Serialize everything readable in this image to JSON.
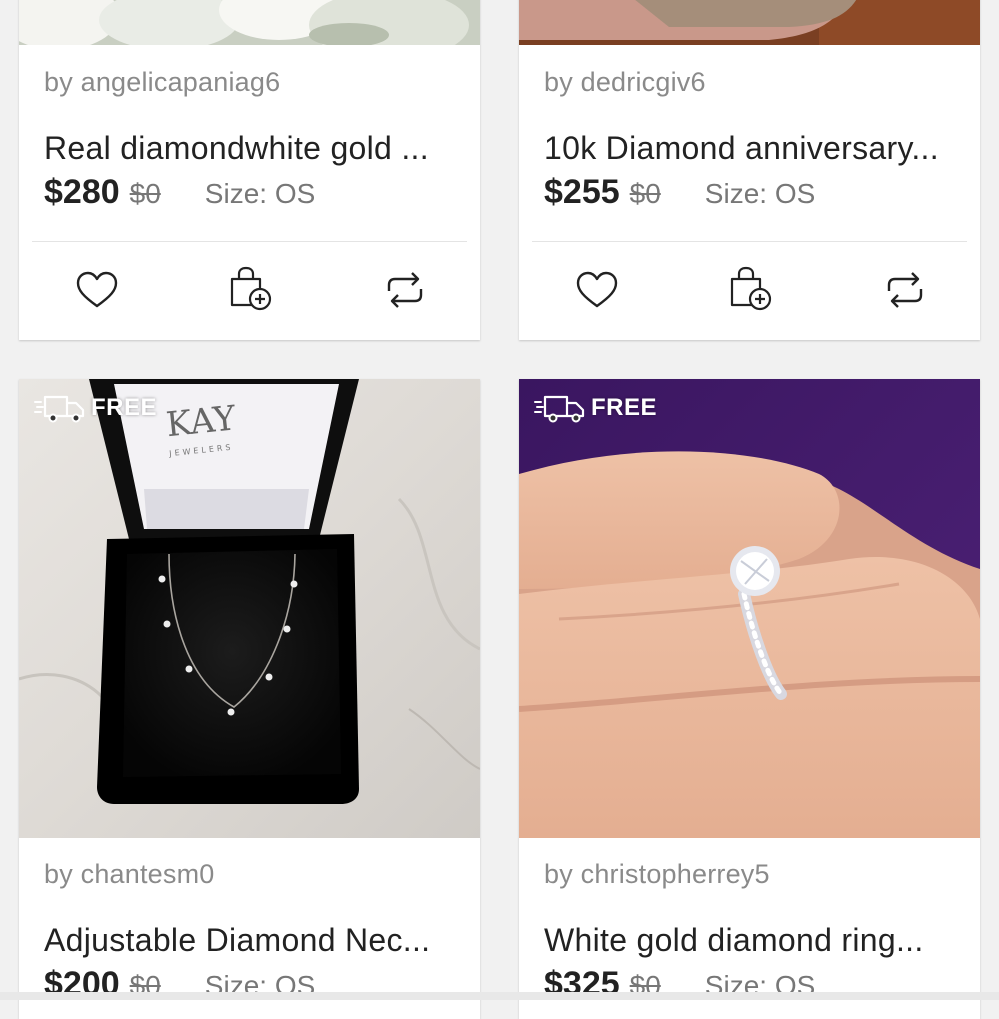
{
  "listings": [
    {
      "seller": "by angelicapaniag6",
      "title": "Real diamondwhite gold ...",
      "price": "$280",
      "original_price": "$0",
      "size": "Size: OS",
      "photo_desc": "white flowers"
    },
    {
      "seller": "by dedricgiv6",
      "title": "10k Diamond anniversary...",
      "price": "$255",
      "original_price": "$0",
      "size": "Size: OS",
      "photo_desc": "finger on wood"
    },
    {
      "seller": "by chantesm0",
      "title": "Adjustable Diamond Nec...",
      "price": "$200",
      "original_price": "$0",
      "size": "Size: OS",
      "badge": "FREE",
      "box_brand": "KAY",
      "box_sub": "JEWELERS"
    },
    {
      "seller": "by christopherrey5",
      "title": "White gold diamond ring...",
      "price": "$325",
      "original_price": "$0",
      "size": "Size: OS",
      "badge": "FREE"
    }
  ],
  "actions": {
    "like_icon": "heart-icon",
    "bundle_icon": "shopping-bag-plus-icon",
    "share_icon": "share-repost-icon"
  },
  "colors": {
    "text_dark": "#222222",
    "text_muted": "#8a8a8a",
    "background": "#f1f1f1"
  }
}
